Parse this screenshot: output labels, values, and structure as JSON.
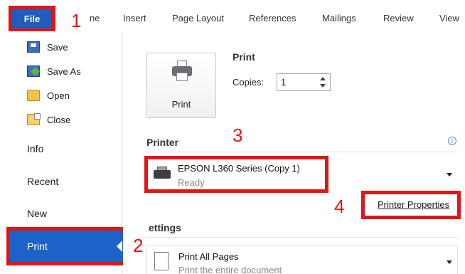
{
  "ribbon": {
    "file_label": "File",
    "tabs": [
      "ne",
      "Insert",
      "Page Layout",
      "References",
      "Mailings",
      "Review",
      "View"
    ]
  },
  "sidebar": {
    "commands": [
      "Save",
      "Save As",
      "Open",
      "Close"
    ],
    "tabs": [
      "Info",
      "Recent",
      "New"
    ],
    "print_label": "Print"
  },
  "print": {
    "heading": "Print",
    "button_label": "Print",
    "copies_label": "Copies:",
    "copies_value": "1"
  },
  "printer": {
    "heading": "Printer",
    "name": "EPSON L360 Series (Copy 1)",
    "status": "Ready",
    "properties_link": "Printer Properties",
    "info_glyph": "i"
  },
  "settings": {
    "heading": "ettings",
    "pages_title": "Print All Pages",
    "pages_subtitle": "Print the entire document"
  },
  "callouts": [
    "1",
    "2",
    "3",
    "4"
  ],
  "colors": {
    "accent_blue": "#1d62c7",
    "highlight_red": "#e01515"
  }
}
